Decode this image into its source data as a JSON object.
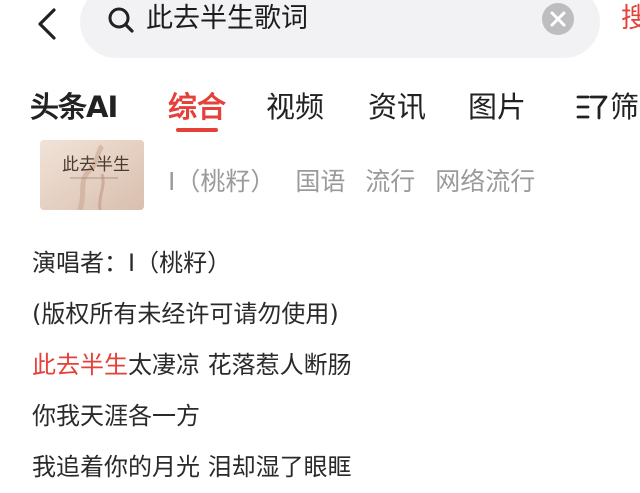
{
  "search": {
    "query": "此去半生歌词",
    "submit_label": "搜"
  },
  "tabs": [
    {
      "label": "头条AI"
    },
    {
      "label": "综合"
    },
    {
      "label": "视频"
    },
    {
      "label": "资讯"
    },
    {
      "label": "图片"
    },
    {
      "label": "筛"
    }
  ],
  "result": {
    "cover_title": "此去半生",
    "artist": "I（桃籽）",
    "tags": [
      "国语",
      "流行",
      "网络流行"
    ]
  },
  "lyrics": {
    "singer_line": "演唱者：I（桃籽）",
    "copyright_line": "(版权所有未经许可请勿使用)",
    "line3_highlight": "此去半生",
    "line3_rest": "太凄凉 花落惹人断肠",
    "line4": "你我天涯各一方",
    "line5": "我追着你的月光 泪却湿了眼眶"
  },
  "colors": {
    "accent": "#e5403a",
    "search_bg": "#f2f2f4",
    "muted_text": "#9a9a9a"
  },
  "icons": [
    "back-icon",
    "search-icon",
    "clear-icon",
    "filter-icon"
  ]
}
